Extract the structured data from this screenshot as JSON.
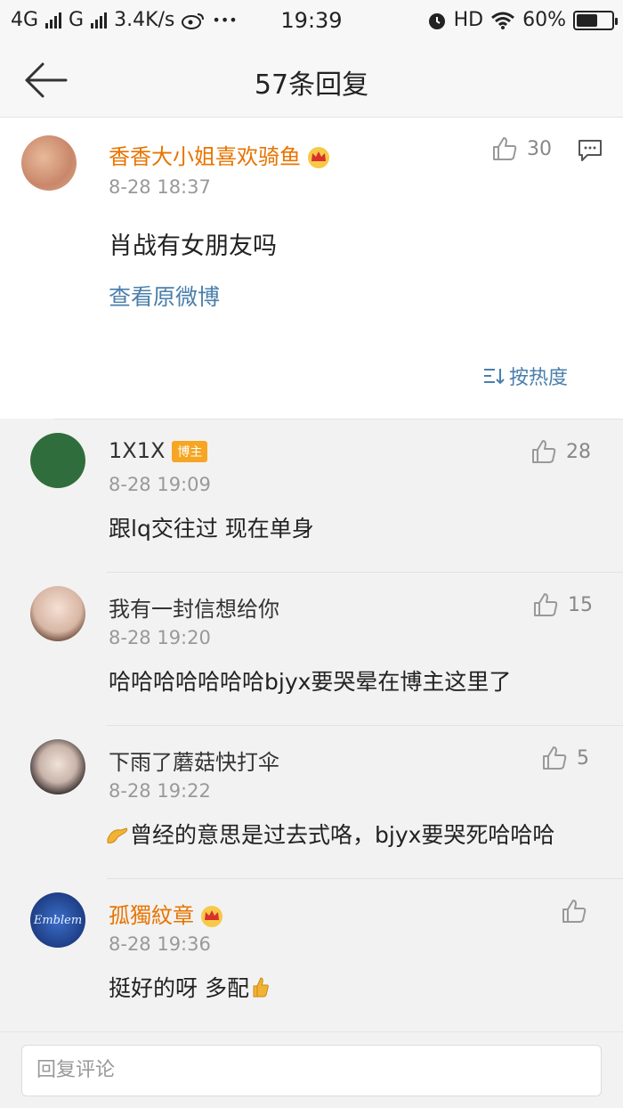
{
  "status_bar": {
    "network1": "4G",
    "network2": "G",
    "speed": "3.4K/s",
    "dots": "•••",
    "time": "19:39",
    "hd": "HD",
    "battery": "60%",
    "battery_level": 0.6
  },
  "nav": {
    "title": "57条回复"
  },
  "post": {
    "author": "香香大小姐喜欢骑鱼",
    "time": "8-28 18:37",
    "text": "肖战有女朋友吗",
    "likes": "30",
    "view_original": "查看原微博",
    "sort_label": "按热度"
  },
  "comments": [
    {
      "author": "1X1X",
      "badge": "博主",
      "time": "8-28 19:09",
      "text": "跟lq交往过 现在单身",
      "likes": "28"
    },
    {
      "author": "我有一封信想给你",
      "time": "8-28 19:20",
      "text": "哈哈哈哈哈哈哈bjyx要哭晕在博主这里了",
      "likes": "15"
    },
    {
      "author": "下雨了蘑菇快打伞",
      "time": "8-28 19:22",
      "text": "曾经的意思是过去式咯，bjyx要哭死哈哈哈",
      "likes": "5"
    },
    {
      "author": "孤獨紋章",
      "time": "8-28 19:36",
      "text": "挺好的呀 多配",
      "likes": "",
      "avatar_text": "Emblem"
    }
  ],
  "reply": {
    "placeholder": "回复评论"
  },
  "colors": {
    "vip_name": "#e87400",
    "link": "#4a7fab",
    "badge": "#f6a623",
    "background": "#f2f2f2"
  }
}
